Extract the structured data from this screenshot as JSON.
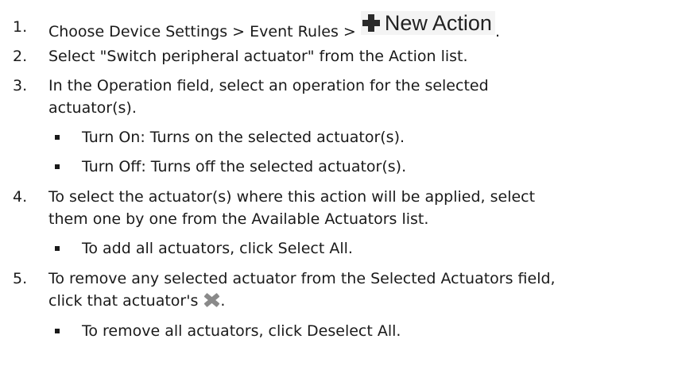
{
  "steps": [
    {
      "number": "1.",
      "text_before": "Choose Device Settings > Event Rules > ",
      "button": {
        "icon": "plus-icon",
        "label": "New Action"
      },
      "text_after": "."
    },
    {
      "number": "2.",
      "text": "Select \"Switch peripheral actuator\" from the Action list."
    },
    {
      "number": "3.",
      "lines": [
        "In the Operation field, select an operation for the selected",
        "actuator(s)."
      ],
      "bullets": [
        "Turn On: Turns on the selected actuator(s).",
        "Turn Off: Turns off the selected actuator(s)."
      ]
    },
    {
      "number": "4.",
      "lines": [
        "To select the actuator(s) where this action will be applied, select",
        "them one by one from the Available Actuators list."
      ],
      "bullets": [
        "To add all actuators, click Select All."
      ]
    },
    {
      "number": "5.",
      "lines": [
        "To remove any selected actuator from the Selected Actuators field,",
        "click that actuator's "
      ],
      "icon": "delete-x-icon",
      "icon_suffix": ".",
      "bullets": [
        "To remove all actuators, click Deselect All."
      ]
    }
  ]
}
